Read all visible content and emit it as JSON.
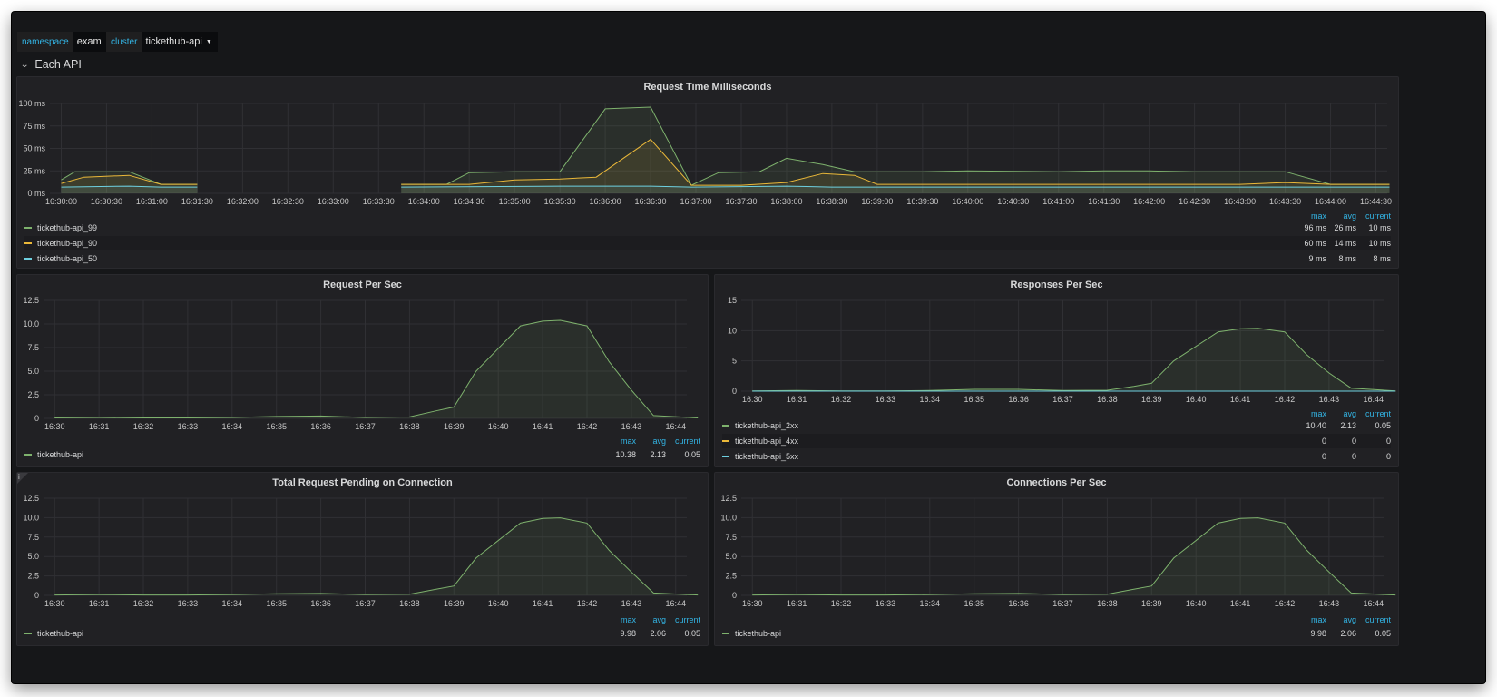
{
  "variables": [
    {
      "label": "namespace",
      "value": "exam"
    },
    {
      "label": "cluster",
      "value": "tickethub-api"
    }
  ],
  "row": {
    "title": "Each API"
  },
  "colors": {
    "green": "#7eb26d",
    "yellow": "#eab839",
    "blue": "#6ed0e0",
    "blue_label": "#33b5e5",
    "bg": "#161719",
    "panel": "#212124"
  },
  "legend_headers": {
    "max": "max",
    "avg": "avg",
    "current": "current"
  },
  "panels": {
    "p1": {
      "title": "Request Time Milliseconds",
      "legend": [
        {
          "name": "tickethub-api_99",
          "color": "#7eb26d",
          "max": "96 ms",
          "avg": "26 ms",
          "current": "10 ms"
        },
        {
          "name": "tickethub-api_90",
          "color": "#eab839",
          "max": "60 ms",
          "avg": "14 ms",
          "current": "10 ms"
        },
        {
          "name": "tickethub-api_50",
          "color": "#6ed0e0",
          "max": "9 ms",
          "avg": "8 ms",
          "current": "8 ms"
        }
      ]
    },
    "p2": {
      "title": "Request Per Sec",
      "legend": [
        {
          "name": "tickethub-api",
          "color": "#7eb26d",
          "max": "10.38",
          "avg": "2.13",
          "current": "0.05"
        }
      ]
    },
    "p3": {
      "title": "Responses Per Sec",
      "legend": [
        {
          "name": "tickethub-api_2xx",
          "color": "#7eb26d",
          "max": "10.40",
          "avg": "2.13",
          "current": "0.05"
        },
        {
          "name": "tickethub-api_4xx",
          "color": "#eab839",
          "max": "0",
          "avg": "0",
          "current": "0"
        },
        {
          "name": "tickethub-api_5xx",
          "color": "#6ed0e0",
          "max": "0",
          "avg": "0",
          "current": "0"
        }
      ]
    },
    "p4": {
      "title": "Total Request Pending on Connection",
      "info": "i",
      "legend": [
        {
          "name": "tickethub-api",
          "color": "#7eb26d",
          "max": "9.98",
          "avg": "2.06",
          "current": "0.05"
        }
      ]
    },
    "p5": {
      "title": "Connections Per Sec",
      "legend": [
        {
          "name": "tickethub-api",
          "color": "#7eb26d",
          "max": "9.98",
          "avg": "2.06",
          "current": "0.05"
        }
      ]
    }
  },
  "chart_data": [
    {
      "id": "p1",
      "type": "line",
      "title": "Request Time Milliseconds",
      "ylim": [
        0,
        100
      ],
      "yticks": [
        "0 ms",
        "25 ms",
        "50 ms",
        "75 ms",
        "100 ms"
      ],
      "xticks": [
        "16:30:00",
        "16:30:30",
        "16:31:00",
        "16:31:30",
        "16:32:00",
        "16:32:30",
        "16:33:00",
        "16:33:30",
        "16:34:00",
        "16:34:30",
        "16:35:00",
        "16:35:30",
        "16:36:00",
        "16:36:30",
        "16:37:00",
        "16:37:30",
        "16:38:00",
        "16:38:30",
        "16:39:00",
        "16:39:30",
        "16:40:00",
        "16:40:30",
        "16:41:00",
        "16:41:30",
        "16:42:00",
        "16:42:30",
        "16:43:00",
        "16:43:30",
        "16:44:00",
        "16:44:30"
      ],
      "series": [
        {
          "name": "tickethub-api_99",
          "color": "#7eb26d",
          "points": [
            [
              0,
              15
            ],
            [
              0.3,
              24
            ],
            [
              1.5,
              24
            ],
            [
              2.2,
              10
            ],
            [
              3,
              10
            ],
            null,
            [
              7.5,
              10
            ],
            [
              8.5,
              10
            ],
            [
              9,
              23
            ],
            [
              10,
              24
            ],
            [
              11,
              24
            ],
            [
              12,
              94
            ],
            [
              13,
              96
            ],
            [
              13.9,
              9
            ],
            [
              14.5,
              23
            ],
            [
              15.4,
              24
            ],
            [
              16,
              39
            ],
            [
              16.8,
              32
            ],
            [
              17.5,
              24
            ],
            [
              19,
              24
            ],
            [
              20,
              25
            ],
            [
              22,
              24
            ],
            [
              23,
              25
            ],
            [
              24,
              25
            ],
            [
              25,
              24
            ],
            [
              26,
              24
            ],
            [
              27,
              24
            ],
            [
              28,
              10
            ],
            [
              29.3,
              10
            ]
          ]
        },
        {
          "name": "tickethub-api_90",
          "color": "#eab839",
          "points": [
            [
              0,
              11
            ],
            [
              0.5,
              18
            ],
            [
              1.5,
              20
            ],
            [
              2.2,
              10
            ],
            [
              3,
              10
            ],
            null,
            [
              7.5,
              10
            ],
            [
              9,
              10
            ],
            [
              10,
              15
            ],
            [
              11,
              16
            ],
            [
              11.8,
              18
            ],
            [
              13,
              60
            ],
            [
              13.9,
              9
            ],
            [
              15,
              9
            ],
            [
              16,
              12
            ],
            [
              16.8,
              22
            ],
            [
              17.5,
              20
            ],
            [
              18,
              10
            ],
            [
              22,
              10
            ],
            [
              26,
              10
            ],
            [
              27,
              12
            ],
            [
              28,
              10
            ],
            [
              29.3,
              10
            ]
          ]
        },
        {
          "name": "tickethub-api_50",
          "color": "#6ed0e0",
          "points": [
            [
              0,
              7
            ],
            [
              1.5,
              8
            ],
            [
              2.2,
              7
            ],
            [
              3,
              7
            ],
            null,
            [
              7.5,
              7
            ],
            [
              11,
              8
            ],
            [
              13,
              8
            ],
            [
              13.9,
              7
            ],
            [
              16,
              8
            ],
            [
              17,
              7
            ],
            [
              22,
              7
            ],
            [
              26,
              7
            ],
            [
              29.3,
              7
            ]
          ]
        }
      ]
    },
    {
      "id": "p2",
      "type": "area",
      "title": "Request Per Sec",
      "ylim": [
        0,
        12.5
      ],
      "yticks": [
        "0",
        "2.5",
        "5.0",
        "7.5",
        "10.0",
        "12.5"
      ],
      "xticks": [
        "16:30",
        "16:31",
        "16:32",
        "16:33",
        "16:34",
        "16:35",
        "16:36",
        "16:37",
        "16:38",
        "16:39",
        "16:40",
        "16:41",
        "16:42",
        "16:43",
        "16:44"
      ],
      "series": [
        {
          "name": "tickethub-api",
          "color": "#7eb26d",
          "points": [
            [
              0,
              0.05
            ],
            [
              1,
              0.1
            ],
            [
              2,
              0.05
            ],
            [
              3,
              0.05
            ],
            [
              4,
              0.1
            ],
            [
              5,
              0.2
            ],
            [
              6,
              0.25
            ],
            [
              7,
              0.1
            ],
            [
              8,
              0.15
            ],
            [
              8.6,
              0.8
            ],
            [
              9,
              1.2
            ],
            [
              9.5,
              5
            ],
            [
              10.5,
              9.8
            ],
            [
              11,
              10.3
            ],
            [
              11.4,
              10.38
            ],
            [
              12,
              9.8
            ],
            [
              12.5,
              6
            ],
            [
              13,
              3
            ],
            [
              13.5,
              0.3
            ],
            [
              14.5,
              0.05
            ]
          ]
        }
      ]
    },
    {
      "id": "p3",
      "type": "area",
      "title": "Responses Per Sec",
      "ylim": [
        0,
        15
      ],
      "yticks": [
        "0",
        "5",
        "10",
        "15"
      ],
      "xticks": [
        "16:30",
        "16:31",
        "16:32",
        "16:33",
        "16:34",
        "16:35",
        "16:36",
        "16:37",
        "16:38",
        "16:39",
        "16:40",
        "16:41",
        "16:42",
        "16:43",
        "16:44"
      ],
      "series": [
        {
          "name": "tickethub-api_2xx",
          "color": "#7eb26d",
          "points": [
            [
              0,
              0.05
            ],
            [
              1,
              0.1
            ],
            [
              2,
              0.05
            ],
            [
              3,
              0.05
            ],
            [
              4,
              0.1
            ],
            [
              5,
              0.3
            ],
            [
              6,
              0.3
            ],
            [
              7,
              0.1
            ],
            [
              8,
              0.15
            ],
            [
              8.6,
              0.8
            ],
            [
              9,
              1.3
            ],
            [
              9.5,
              5
            ],
            [
              10.5,
              9.8
            ],
            [
              11,
              10.3
            ],
            [
              11.4,
              10.4
            ],
            [
              12,
              9.8
            ],
            [
              12.5,
              6
            ],
            [
              13,
              3
            ],
            [
              13.5,
              0.5
            ],
            [
              14.5,
              0.05
            ]
          ]
        },
        {
          "name": "tickethub-api_4xx",
          "color": "#eab839",
          "points": [
            [
              0,
              0
            ],
            [
              14.5,
              0
            ]
          ]
        },
        {
          "name": "tickethub-api_5xx",
          "color": "#6ed0e0",
          "points": [
            [
              0,
              0
            ],
            [
              14.5,
              0
            ]
          ]
        }
      ]
    },
    {
      "id": "p4",
      "type": "area",
      "title": "Total Request Pending on Connection",
      "ylim": [
        0,
        12.5
      ],
      "yticks": [
        "0",
        "2.5",
        "5.0",
        "7.5",
        "10.0",
        "12.5"
      ],
      "xticks": [
        "16:30",
        "16:31",
        "16:32",
        "16:33",
        "16:34",
        "16:35",
        "16:36",
        "16:37",
        "16:38",
        "16:39",
        "16:40",
        "16:41",
        "16:42",
        "16:43",
        "16:44"
      ],
      "series": [
        {
          "name": "tickethub-api",
          "color": "#7eb26d",
          "points": [
            [
              0,
              0.05
            ],
            [
              1,
              0.1
            ],
            [
              2,
              0.05
            ],
            [
              3,
              0.05
            ],
            [
              4,
              0.1
            ],
            [
              5,
              0.2
            ],
            [
              6,
              0.25
            ],
            [
              7,
              0.1
            ],
            [
              8,
              0.15
            ],
            [
              8.6,
              0.8
            ],
            [
              9,
              1.2
            ],
            [
              9.5,
              4.8
            ],
            [
              10.5,
              9.3
            ],
            [
              11,
              9.9
            ],
            [
              11.4,
              9.98
            ],
            [
              12,
              9.3
            ],
            [
              12.5,
              5.8
            ],
            [
              13,
              3
            ],
            [
              13.5,
              0.3
            ],
            [
              14.5,
              0.05
            ]
          ]
        }
      ]
    },
    {
      "id": "p5",
      "type": "area",
      "title": "Connections Per Sec",
      "ylim": [
        0,
        12.5
      ],
      "yticks": [
        "0",
        "2.5",
        "5.0",
        "7.5",
        "10.0",
        "12.5"
      ],
      "xticks": [
        "16:30",
        "16:31",
        "16:32",
        "16:33",
        "16:34",
        "16:35",
        "16:36",
        "16:37",
        "16:38",
        "16:39",
        "16:40",
        "16:41",
        "16:42",
        "16:43",
        "16:44"
      ],
      "series": [
        {
          "name": "tickethub-api",
          "color": "#7eb26d",
          "points": [
            [
              0,
              0.05
            ],
            [
              1,
              0.1
            ],
            [
              2,
              0.05
            ],
            [
              3,
              0.05
            ],
            [
              4,
              0.1
            ],
            [
              5,
              0.2
            ],
            [
              6,
              0.25
            ],
            [
              7,
              0.1
            ],
            [
              8,
              0.15
            ],
            [
              8.6,
              0.8
            ],
            [
              9,
              1.2
            ],
            [
              9.5,
              4.8
            ],
            [
              10.5,
              9.3
            ],
            [
              11,
              9.9
            ],
            [
              11.4,
              9.98
            ],
            [
              12,
              9.3
            ],
            [
              12.5,
              5.8
            ],
            [
              13,
              3
            ],
            [
              13.5,
              0.3
            ],
            [
              14.5,
              0.05
            ]
          ]
        }
      ]
    }
  ]
}
